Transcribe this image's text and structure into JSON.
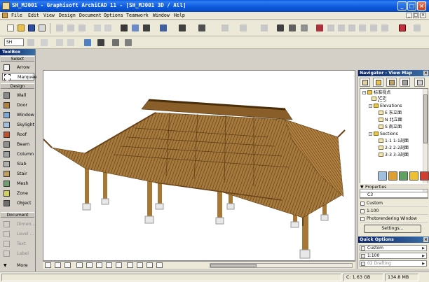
{
  "window": {
    "title": "SH_MJ001 - Graphisoft ArchiCAD 11 - [SH_MJ001 3D / All]",
    "minimize": "_",
    "maximize": "□",
    "close": "×"
  },
  "menubar": {
    "items": [
      "File",
      "Edit",
      "View",
      "Design",
      "Document",
      "Options",
      "Teamwork",
      "Window",
      "Help"
    ],
    "mdi_buttons": [
      "_",
      "□",
      "×"
    ]
  },
  "toolbars": {
    "story_dropdown": "SH"
  },
  "toolbox": {
    "title": "ToolBox",
    "groups": [
      "Select",
      "Design",
      "Document"
    ],
    "select_tools": [
      "Arrow",
      "Marquee"
    ],
    "design_tools": [
      "Wall",
      "Door",
      "Window",
      "Skylight",
      "Roof",
      "Beam",
      "Column",
      "Slab",
      "Stair",
      "Mesh",
      "Zone",
      "Object"
    ],
    "document_tools": [
      "Dimen...",
      "Level ...",
      "Text",
      "Label"
    ],
    "more": "More",
    "icon_colors": {
      "Arrow": "#f4f4f4",
      "Marquee": "#ffffff",
      "Wall": "#8a8a8a",
      "Door": "#b08040",
      "Window": "#7aa8d8",
      "Skylight": "#a0c0e0",
      "Roof": "#c05030",
      "Beam": "#909090",
      "Column": "#a0a0a0",
      "Slab": "#b0b0b0",
      "Stair": "#c0a060",
      "Mesh": "#70a070",
      "Zone": "#d0d060",
      "Object": "#707070"
    }
  },
  "navigator": {
    "title": "Navigator - View Map",
    "tree": [
      {
        "label": "标准视点",
        "level": 0,
        "icon": "folder-icon"
      },
      {
        "label": "C3",
        "level": 1,
        "icon": "view-icon"
      },
      {
        "label": "Elevations",
        "level": 1,
        "icon": "folder-icon"
      },
      {
        "label": "E 东立面",
        "level": 2,
        "icon": "view-icon"
      },
      {
        "label": "N 北立面",
        "level": 2,
        "icon": "view-icon"
      },
      {
        "label": "S 南立面",
        "level": 2,
        "icon": "view-icon"
      },
      {
        "label": "Sections",
        "level": 1,
        "icon": "folder-icon"
      },
      {
        "label": "1-1 1-1剖面",
        "level": 2,
        "icon": "view-icon"
      },
      {
        "label": "2-2 2-2剖面",
        "level": 2,
        "icon": "view-icon"
      },
      {
        "label": "3-3 3-3剖面",
        "level": 2,
        "icon": "view-icon"
      }
    ],
    "button_colors": [
      "#a0c0e0",
      "#e0a030",
      "#60a060",
      "#f0c030",
      "#d04030"
    ],
    "properties_header": "Properties",
    "properties_id": "C3",
    "properties": [
      "Custom",
      "1:100",
      "Photorendering Window"
    ],
    "settings_button": "Settings..."
  },
  "quick_options": {
    "title": "Quick Options",
    "items": [
      "Custom",
      "1:100",
      "02 Drafting"
    ]
  },
  "status": {
    "coords_label": "C:",
    "disk": "1.63 GB",
    "memory": "134.8 MB"
  }
}
